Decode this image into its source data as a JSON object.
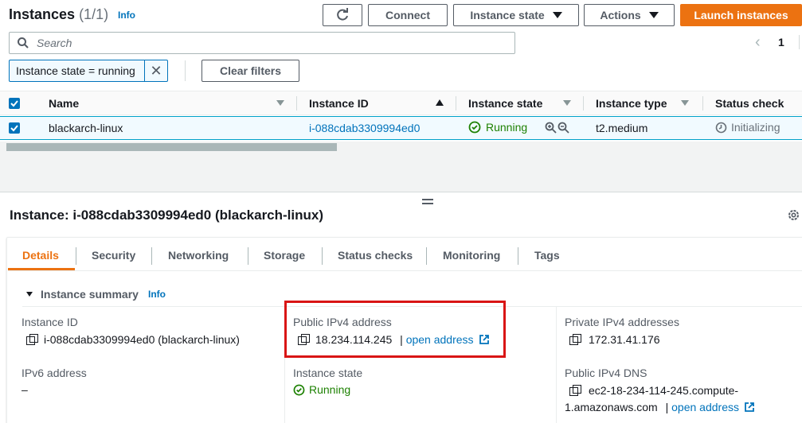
{
  "header": {
    "title": "Instances",
    "count": "(1/1)",
    "info": "Info",
    "connect": "Connect",
    "instance_state": "Instance state",
    "actions": "Actions",
    "launch": "Launch instances"
  },
  "search": {
    "placeholder": "Search"
  },
  "pagination": {
    "page": "1"
  },
  "filter": {
    "chip": "Instance state = running",
    "clear": "Clear filters"
  },
  "table": {
    "columns": [
      "Name",
      "Instance ID",
      "Instance state",
      "Instance type",
      "Status check"
    ],
    "row": {
      "name": "blackarch-linux",
      "id": "i-088cdab3309994ed0",
      "state": "Running",
      "type": "t2.medium",
      "status": "Initializing"
    }
  },
  "detail": {
    "title": "Instance: i-088cdab3309994ed0 (blackarch-linux)",
    "tabs": [
      "Details",
      "Security",
      "Networking",
      "Storage",
      "Status checks",
      "Monitoring",
      "Tags"
    ],
    "summary_title": "Instance summary",
    "summary_info": "Info",
    "instance_id_label": "Instance ID",
    "instance_id_value": "i-088cdab3309994ed0 (blackarch-linux)",
    "public_ipv4_label": "Public IPv4 address",
    "public_ipv4_value": "18.234.114.245",
    "separator": " | ",
    "open_address": "open address",
    "private_ipv4_label": "Private IPv4 addresses",
    "private_ipv4_value": "172.31.41.176",
    "ipv6_label": "IPv6 address",
    "ipv6_value": "–",
    "instance_state_label": "Instance state",
    "instance_state_value": "Running",
    "public_dns_label": "Public IPv4 DNS",
    "public_dns_line1": "ec2-18-234-114-245.compute-",
    "public_dns_line2": "1.amazonaws.com",
    "open_address2": "open address"
  },
  "colors": {
    "accent": "#ec7211",
    "link": "#0073bb",
    "running": "#1d8102",
    "highlight": "#d91515"
  }
}
